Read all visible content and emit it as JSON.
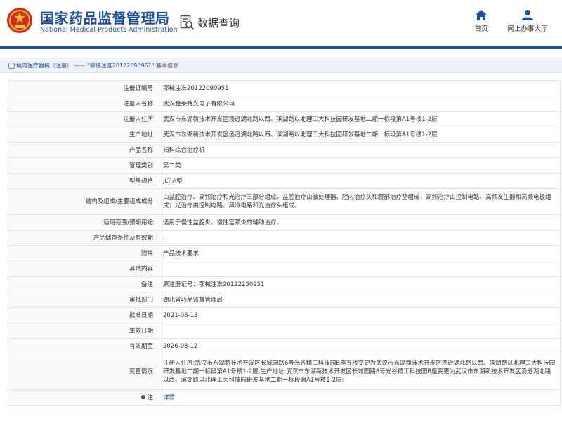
{
  "header": {
    "title_cn": "国家药品监督管理局",
    "title_en": "National Medical Products Administration",
    "section": "数据查询",
    "nav": [
      {
        "label": "首页",
        "icon": "home-icon"
      },
      {
        "label": "网上办事大厅",
        "icon": "user-icon"
      }
    ]
  },
  "breadcrumb": {
    "category": "境内医疗器械（注册）",
    "separator": "——",
    "item": "\"鄂械注准20122090951\"",
    "suffix": "基本信息"
  },
  "colors": {
    "brand": "#1f4e98",
    "emblem": "#d42a1e"
  },
  "fields": [
    {
      "key": "注册证编号",
      "value": "鄂械注准20122090951"
    },
    {
      "key": "注册人名称",
      "value": "武汉金莱特光电子有限公司"
    },
    {
      "key": "注册人住所",
      "value": "武汉市东湖新技术开发区汤逊湖北路以西、滨湖路以北理工大科技园研发基地二期一标段第A1号楼1-2层"
    },
    {
      "key": "生产地址",
      "value": "武汉市东湖新技术开发区汤逊湖北路以西、滨湖路以北理工大科技园研发基地二期一标段第A1号楼1-2层"
    },
    {
      "key": "产品名称",
      "value": "妇科综合治疗机"
    },
    {
      "key": "管理类别",
      "value": "第二类"
    },
    {
      "key": "型号规格",
      "value": "JLT-A型"
    },
    {
      "key": "结构及组成/主要组成成分",
      "value": "由盆腔治疗、高频治疗和光治疗三部分组成。盆腔治疗由微处理器、腔内治疗头和腰部治疗垫组成；高频治疗由控制电路、高频发生器和高频电极组成；光治疗由控制电路、风冷电路和光治疗头组成。"
    },
    {
      "key": "适用范围/预期用途",
      "value": "适用于慢性盆腔炎、慢性宫颈炎的辅助治疗。"
    },
    {
      "key": "产品储存条件及有效期",
      "value": "-"
    },
    {
      "key": "附件",
      "value": "产品技术要求"
    },
    {
      "key": "其他内容",
      "value": ""
    },
    {
      "key": "备注",
      "value": "原注册证号：鄂械注准20122250951"
    },
    {
      "key": "审批部门",
      "value": "湖北省药品监督管理局"
    },
    {
      "key": "批准日期",
      "value": "2021-08-13"
    },
    {
      "key": "生效日期",
      "value": ""
    },
    {
      "key": "有效期至",
      "value": "2026-08-12"
    },
    {
      "key": "变更情况",
      "value": "注册人住所:武汉市东湖新技术开发区长城园路8号光谷精工科技园B座五楼变更为武汉市东湖新技术开发区汤逊湖北路以西、滨湖路以北理工大科技园研发基地二期一标段第A1号楼1-2层;生产地址:武汉市东湖新技术开发区长城园路8号光谷精工科技园B座变更为武汉市东湖新技术开发区汤逊湖北路以西、滨湖路以北理工大科技园研发基地二期一标段第A1号楼1-2层;"
    },
    {
      "key": "注",
      "value": "详情"
    }
  ]
}
